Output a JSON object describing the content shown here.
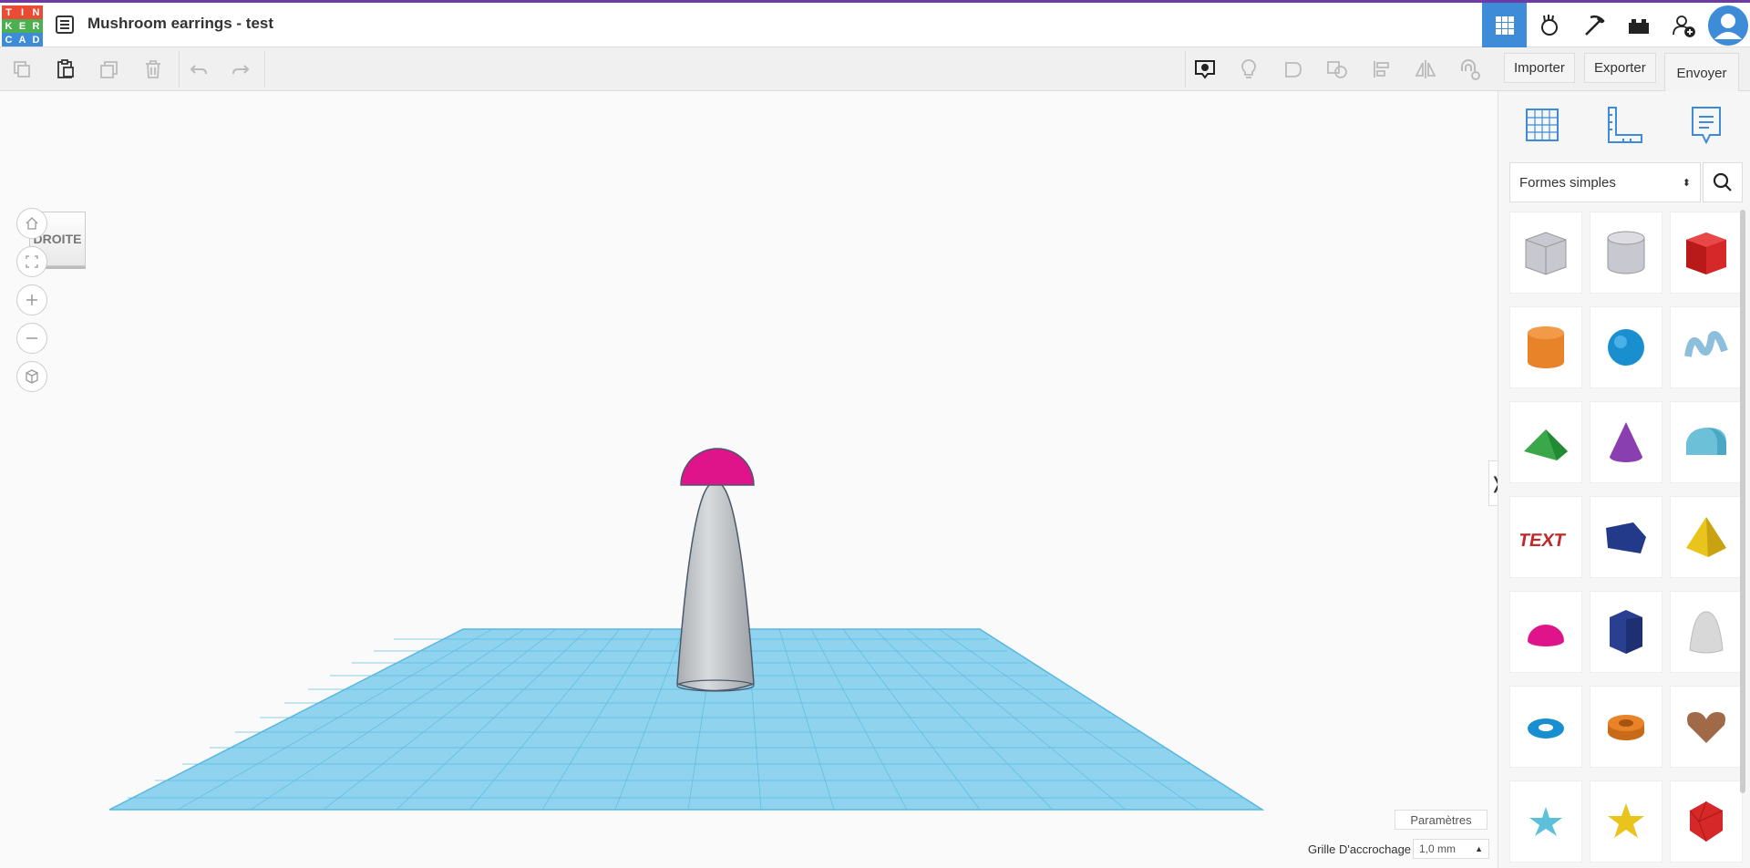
{
  "app": {
    "logo_letters": [
      "T",
      "I",
      "N",
      "K",
      "E",
      "R",
      "C",
      "A",
      "D"
    ],
    "logo_colors": [
      "#e94b35",
      "#e94b35",
      "#e94b35",
      "#4caf50",
      "#4caf50",
      "#4caf50",
      "#3e8bd8",
      "#3e8bd8",
      "#3e8bd8"
    ],
    "design_title": "Mushroom earrings - test",
    "accent": "#3e8bd8"
  },
  "top_nav": {
    "icons": [
      "grid-view-icon",
      "tinker-hand-icon",
      "pickaxe-icon",
      "brick-icon",
      "add-user-icon",
      "avatar-icon"
    ],
    "active_index": 0
  },
  "toolbar": {
    "left_icons": [
      "copy-icon",
      "paste-icon",
      "duplicate-icon",
      "delete-icon",
      "undo-icon",
      "redo-icon"
    ],
    "right_icons": [
      "notes-icon",
      "light-bulb-icon",
      "group-icon",
      "ungroup-icon",
      "align-icon",
      "mirror-icon",
      "magnet-icon"
    ],
    "import_label": "Importer",
    "export_label": "Exporter",
    "send_label": "Envoyer vers"
  },
  "viewcube": {
    "face_label": "DROITE"
  },
  "nav_controls": [
    "home-view-icon",
    "fit-view-icon",
    "zoom-in-icon",
    "zoom-out-icon",
    "perspective-icon"
  ],
  "panel": {
    "tab_icons": [
      "workplane-icon",
      "ruler-icon",
      "notes-panel-icon"
    ],
    "category": "Formes simples",
    "shapes": [
      {
        "name": "box-hole",
        "color": "#c8c8d0"
      },
      {
        "name": "cylinder-hole",
        "color": "#c8c8d0"
      },
      {
        "name": "box",
        "color": "#d62828"
      },
      {
        "name": "cylinder",
        "color": "#e8832a"
      },
      {
        "name": "sphere",
        "color": "#1a8fd0"
      },
      {
        "name": "scribble",
        "color": "#8bbfdc"
      },
      {
        "name": "roof",
        "color": "#3aa84a"
      },
      {
        "name": "cone",
        "color": "#8a3fb0"
      },
      {
        "name": "round-roof",
        "color": "#6cc0d8"
      },
      {
        "name": "text",
        "color": "#c0282a"
      },
      {
        "name": "wedge",
        "color": "#233a8a"
      },
      {
        "name": "pyramid",
        "color": "#e8c41c"
      },
      {
        "name": "half-sphere",
        "color": "#e0148a"
      },
      {
        "name": "polygon",
        "color": "#2a3f90"
      },
      {
        "name": "paraboloid",
        "color": "#d8d8d8"
      },
      {
        "name": "torus",
        "color": "#1a8fd0"
      },
      {
        "name": "tube",
        "color": "#e8832a"
      },
      {
        "name": "heart",
        "color": "#a06a48"
      },
      {
        "name": "star",
        "color": "#5cc0d8"
      },
      {
        "name": "star-yellow",
        "color": "#e8c41c"
      },
      {
        "name": "icosahedron",
        "color": "#d62828"
      }
    ]
  },
  "footer": {
    "settings_label": "Paramètres",
    "snap_label": "Grille D'accrochage",
    "snap_value": "1,0 mm"
  },
  "scene": {
    "cap_color": "#e0148a",
    "stem_color": "#c8ccd0",
    "plane_color": "#8fd3ee"
  }
}
